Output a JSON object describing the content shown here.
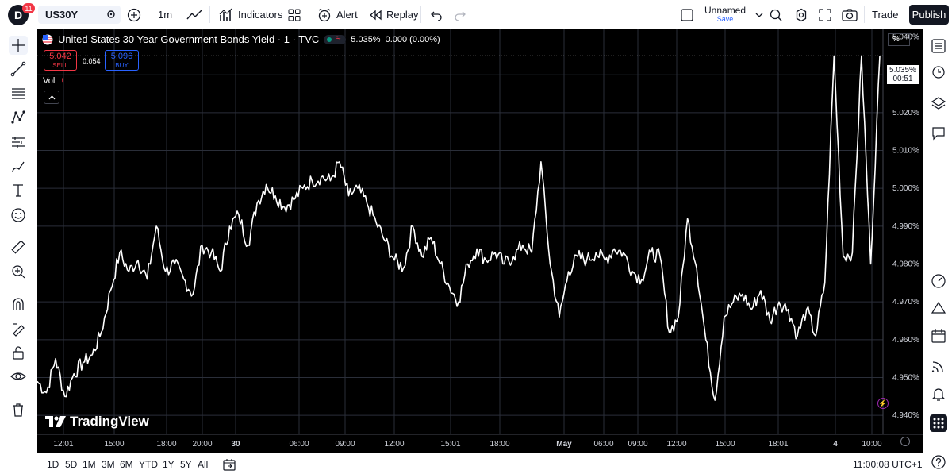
{
  "header": {
    "logo": "D",
    "notification_count": "11",
    "symbol": "US30Y",
    "interval": "1m",
    "indicators_label": "Indicators",
    "alert_label": "Alert",
    "replay_label": "Replay",
    "layout_name": "Unnamed",
    "layout_save": "Save",
    "trade_label": "Trade",
    "publish_label": "Publish"
  },
  "legend": {
    "title": "United States 30 Year Government Bonds Yield · 1 · TVC",
    "last": "5.035%",
    "change": "0.000 (0.00%)",
    "sell_price": "5.042",
    "sell_label": "SELL",
    "spread": "0.054",
    "buy_price": "5.096",
    "buy_label": "BUY",
    "vol_label": "Vol"
  },
  "watermark": "TradingView",
  "axis": {
    "unit_label": "%",
    "price_badge": "5.035%",
    "countdown": "00:51"
  },
  "bottom": {
    "ranges": [
      "1D",
      "5D",
      "1M",
      "3M",
      "6M",
      "YTD",
      "1Y",
      "5Y",
      "All"
    ],
    "clock": "11:00:08 UTC+1"
  },
  "colors": {
    "background": "#000000",
    "series": "#ffffff",
    "sell": "#f23645",
    "buy": "#2962ff",
    "grid": "#2a2e39",
    "accent_dark": "#131722"
  },
  "icons": [
    "crosshair-icon",
    "trendline-icon",
    "fib-icon",
    "pattern-icon",
    "forecast-icon",
    "brush-icon",
    "text-icon",
    "emoji-icon",
    "ruler-icon",
    "zoom-icon",
    "magnet-icon",
    "lock-draw-icon",
    "lock-icon",
    "eye-icon",
    "trash-icon"
  ],
  "chart_data": {
    "type": "line",
    "title": "United States 30 Year Government Bonds Yield · 1 · TVC",
    "xlabel": "",
    "ylabel": "",
    "x_tick_labels": [
      "12:01",
      "15:00",
      "18:00",
      "20:00",
      "30",
      "06:00",
      "09:00",
      "12:00",
      "15:01",
      "18:00",
      "May",
      "06:00",
      "09:00",
      "12:00",
      "15:00",
      "18:01",
      "4",
      "10:00"
    ],
    "y_tick_labels": [
      "5.040%",
      "5.030%",
      "5.020%",
      "5.010%",
      "5.000%",
      "4.990%",
      "4.980%",
      "4.970%",
      "4.960%",
      "4.950%",
      "4.940%"
    ],
    "ylim": [
      4.935,
      5.042
    ],
    "grid": true,
    "series": [
      {
        "values": [
          4.949,
          4.946,
          4.955,
          4.945,
          4.951,
          4.954,
          4.956,
          4.962,
          4.973,
          4.983,
          4.978,
          4.981,
          4.976,
          4.99,
          4.978,
          4.98,
          4.976,
          4.972,
          4.985,
          4.983,
          4.978,
          4.99,
          4.993,
          4.985,
          4.996,
          5.001,
          4.998,
          4.995,
          4.997,
          5.0,
          5.002,
          5.003,
          5.002,
          5.007,
          4.998,
          5.0,
          4.996,
          4.991,
          4.986,
          4.981,
          4.979,
          4.99,
          4.982,
          4.987,
          4.98,
          4.974,
          4.97,
          4.98,
          4.984,
          4.981,
          4.983,
          4.98,
          4.982,
          4.985,
          4.983,
          5.007,
          4.98,
          4.966,
          4.978,
          4.982,
          4.981,
          4.983,
          4.981,
          4.984,
          4.983,
          4.978,
          4.976,
          4.983,
          4.982,
          4.962,
          4.966,
          4.992,
          4.979,
          4.96,
          4.944,
          4.966,
          4.97,
          4.972,
          4.968,
          4.973,
          4.965,
          4.97,
          4.968,
          4.961,
          4.968,
          4.961,
          4.975,
          5.035,
          4.982,
          4.983,
          5.035,
          4.98,
          5.035
        ]
      }
    ]
  }
}
